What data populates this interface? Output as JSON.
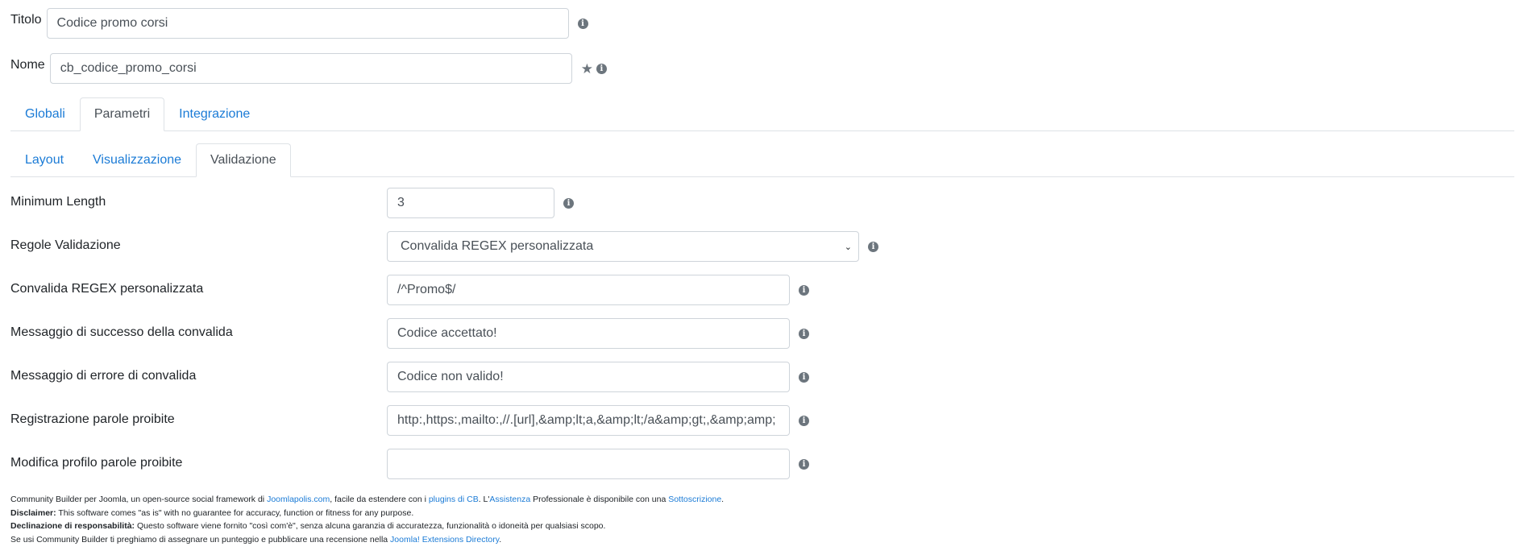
{
  "top_fields": {
    "title": {
      "label": "Titolo",
      "value": "Codice promo corsi"
    },
    "name": {
      "label": "Nome",
      "value": "cb_codice_promo_corsi"
    }
  },
  "main_tabs": [
    {
      "label": "Globali",
      "active": false
    },
    {
      "label": "Parametri",
      "active": true
    },
    {
      "label": "Integrazione",
      "active": false
    }
  ],
  "sub_tabs": [
    {
      "label": "Layout",
      "active": false
    },
    {
      "label": "Visualizzazione",
      "active": false
    },
    {
      "label": "Validazione",
      "active": true
    }
  ],
  "form": {
    "min_length": {
      "label": "Minimum Length",
      "value": "3"
    },
    "validation_rules": {
      "label": "Regole Validazione",
      "selected": "Convalida REGEX personalizzata"
    },
    "custom_regex": {
      "label": "Convalida REGEX personalizzata",
      "value": "/^Promo$/"
    },
    "success_message": {
      "label": "Messaggio di successo della convalida",
      "value": "Codice accettato!"
    },
    "error_message": {
      "label": "Messaggio di errore di convalida",
      "value": "Codice non valido!"
    },
    "register_forbidden": {
      "label": "Registrazione parole proibite",
      "value": "http:,https:,mailto:,//.[url],&amp;lt;a,&amp;lt;/a&amp;gt;,&amp;amp;"
    },
    "profile_forbidden": {
      "label": "Modifica profilo parole proibite",
      "value": ""
    }
  },
  "footer": {
    "line1_a": "Community Builder per Joomla, un open-source social framework di ",
    "line1_link1": "Joomlapolis.com",
    "line1_b": ", facile da estendere con i ",
    "line1_link2": "plugins di CB",
    "line1_c": ". L'",
    "line1_link3": "Assistenza",
    "line1_d": " Professionale è disponibile con una ",
    "line1_link4": "Sottoscrizione",
    "line1_e": ".",
    "line2_bold": "Disclaimer:",
    "line2_text": " This software comes \"as is\" with no guarantee for accuracy, function or fitness for any purpose.",
    "line3_bold": "Declinazione di responsabilità:",
    "line3_text": " Questo software viene fornito \"così com'è\", senza alcuna garanzia di accuratezza, funzionalità o idoneità per qualsiasi scopo.",
    "line4_a": "Se usi Community Builder ti preghiamo di assegnare un punteggio e pubblicare una recensione nella ",
    "line4_link": "Joomla! Extensions Directory",
    "line4_b": "."
  },
  "icons": {
    "info": "i",
    "star": "★",
    "chevron": "⌄"
  },
  "colors": {
    "link": "#1b7bd6",
    "border": "#ced4da",
    "tab_border": "#dee2e6",
    "icon": "#6c757d"
  }
}
